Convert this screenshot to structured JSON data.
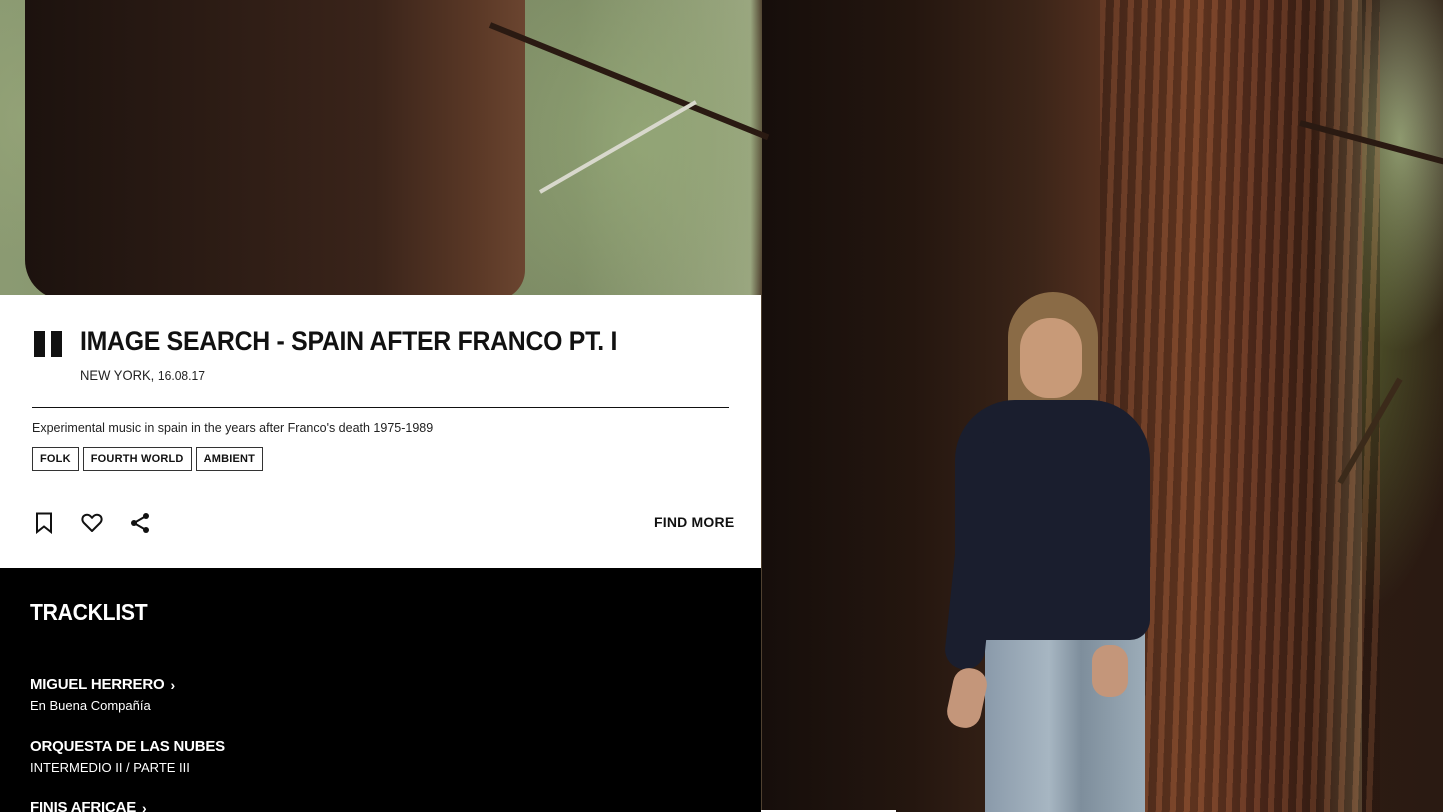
{
  "card": {
    "title": "IMAGE SEARCH - SPAIN AFTER FRANCO PT. I",
    "location": "NEW YORK,",
    "date": "16.08.17",
    "description": "Experimental music in spain in the years after Franco's death 1975-1989",
    "tags": [
      "FOLK",
      "FOURTH WORLD",
      "AMBIENT"
    ],
    "find_more_label": "FIND MORE",
    "icons": {
      "player": "pause-icon",
      "bookmark": "bookmark-icon",
      "like": "heart-icon",
      "share": "share-icon"
    }
  },
  "tracklist": {
    "title": "TRACKLIST",
    "tracks": [
      {
        "artist": "MIGUEL HERRERO",
        "title": "En Buena Compañía"
      },
      {
        "artist": "ORQUESTA DE LAS NUBES",
        "title": "INTERMEDIO II / PARTE III"
      },
      {
        "artist": "FINIS AFRICAE",
        "title": ""
      }
    ]
  },
  "colors": {
    "card_bg": "#ffffff",
    "tracklist_bg": "#000000",
    "text_dark": "#111111",
    "text_light": "#ffffff"
  }
}
